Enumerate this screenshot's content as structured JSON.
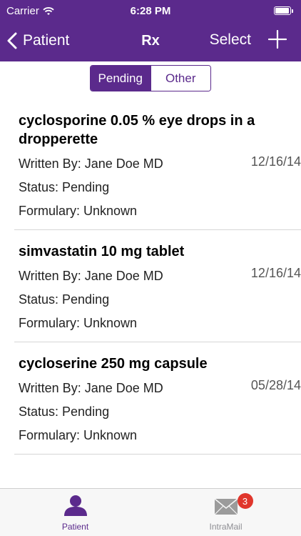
{
  "status_bar": {
    "carrier": "Carrier",
    "time": "6:28 PM"
  },
  "nav": {
    "back_label": "Patient",
    "title": "Rx",
    "select_label": "Select"
  },
  "segments": [
    {
      "label": "Pending",
      "selected": true
    },
    {
      "label": "Other",
      "selected": false
    }
  ],
  "rx_items": [
    {
      "name": "cyclosporine 0.05 % eye drops in a dropperette",
      "written_by": "Written By: Jane Doe MD",
      "date": "12/16/14",
      "status": "Status: Pending",
      "formulary": "Formulary: Unknown"
    },
    {
      "name": "simvastatin 10 mg tablet",
      "written_by": "Written By: Jane Doe MD",
      "date": "12/16/14",
      "status": "Status: Pending",
      "formulary": "Formulary: Unknown"
    },
    {
      "name": "cycloserine 250 mg capsule",
      "written_by": "Written By: Jane Doe MD",
      "date": "05/28/14",
      "status": "Status: Pending",
      "formulary": "Formulary: Unknown"
    }
  ],
  "tabbar": {
    "tabs": [
      {
        "label": "Patient",
        "icon": "person-icon",
        "active": true
      },
      {
        "label": "IntraMail",
        "icon": "envelope-icon",
        "active": false,
        "badge": "3"
      }
    ]
  },
  "colors": {
    "brand": "#5b2a8c",
    "badge": "#e0362c"
  }
}
